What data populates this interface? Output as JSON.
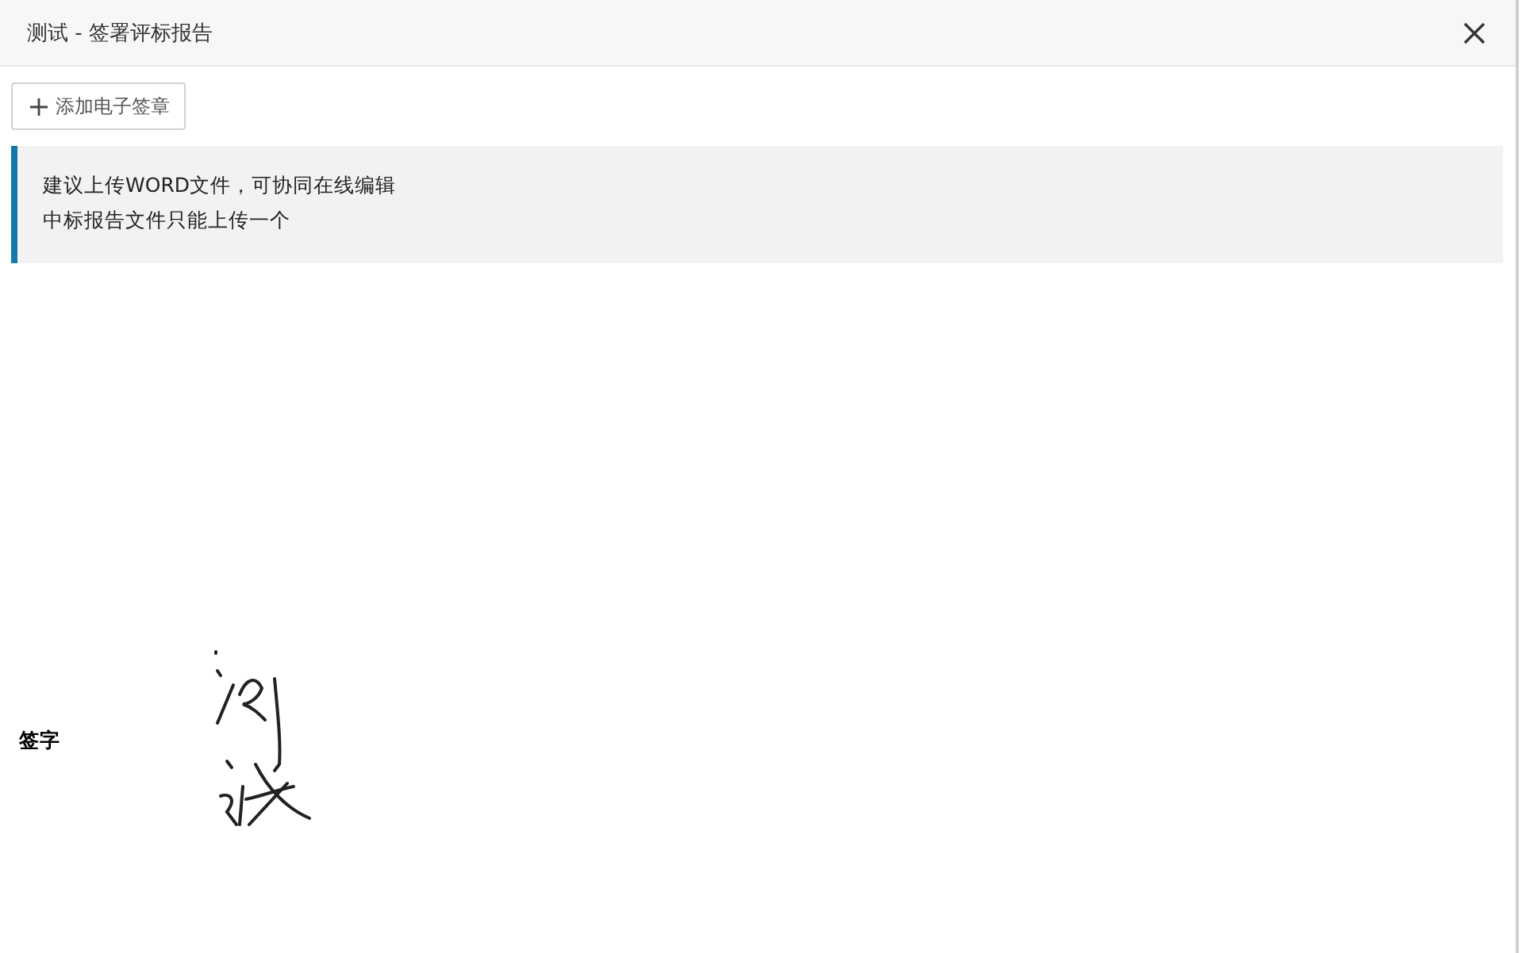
{
  "window": {
    "title": "测试 - 签署评标报告"
  },
  "toolbar": {
    "add_button": "添加电子签章"
  },
  "notice": {
    "lines": [
      "建议上传WORD文件，可协同在线编辑",
      "中标报告文件只能上传一个"
    ]
  },
  "signature": {
    "label": "签字"
  }
}
